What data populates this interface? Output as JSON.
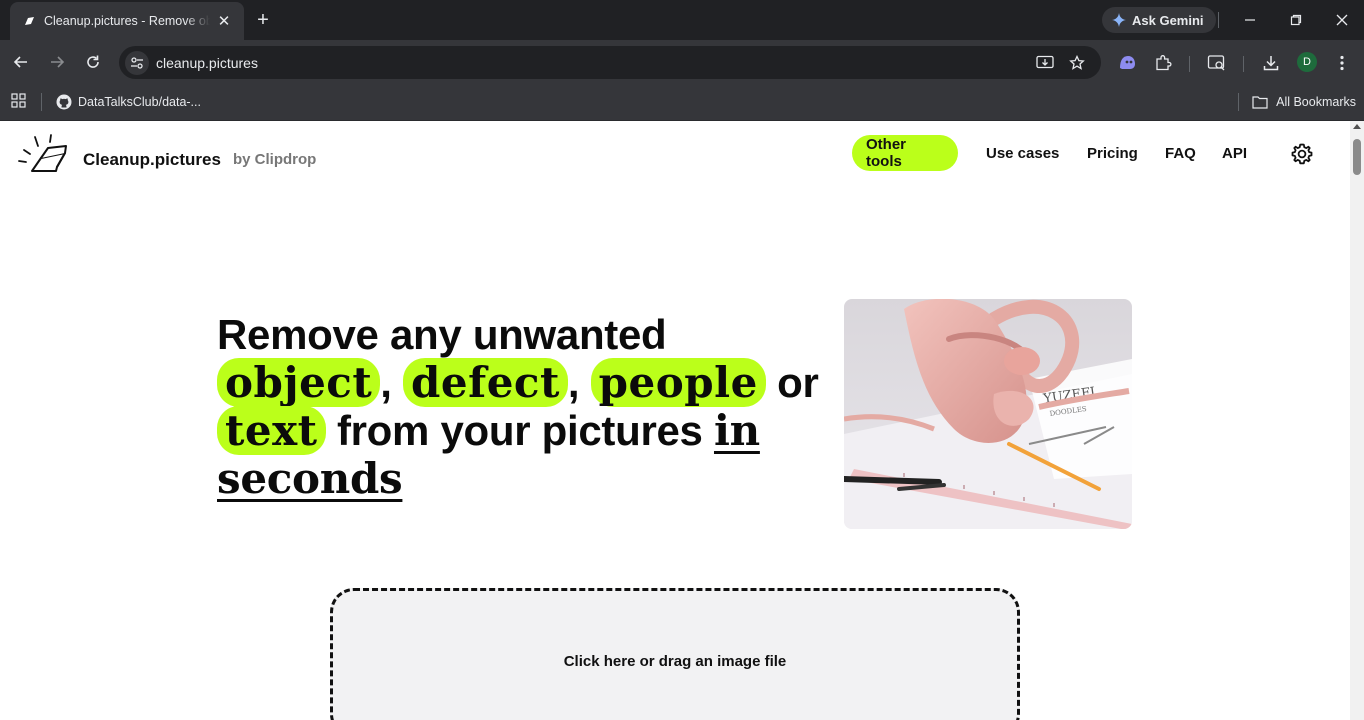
{
  "browser": {
    "tab_title": "Cleanup.pictures - Remove objects",
    "url": "cleanup.pictures",
    "gemini_label": "Ask Gemini",
    "avatar_letter": "D",
    "bookmark_1": "DataTalksClub/data-...",
    "all_bookmarks": "All Bookmarks"
  },
  "site": {
    "brand": "Cleanup.pictures",
    "brand_by": "by Clipdrop",
    "nav": {
      "other_tools": "Other tools",
      "use_cases": "Use cases",
      "pricing": "Pricing",
      "faq": "FAQ",
      "api": "API"
    },
    "headline": {
      "part1": "Remove any unwanted",
      "word_object": "object",
      "comma1": ",",
      "word_defect": "defect",
      "comma2": ",",
      "word_people": "people",
      "or": "or",
      "word_text": "text",
      "part2": "from your pictures",
      "in": "in",
      "seconds": "seconds"
    },
    "dropzone_text": "Click here or drag an image file"
  },
  "colors": {
    "accent": "#bbff1a",
    "chrome_dark": "#202124",
    "chrome_mid": "#35363a"
  }
}
